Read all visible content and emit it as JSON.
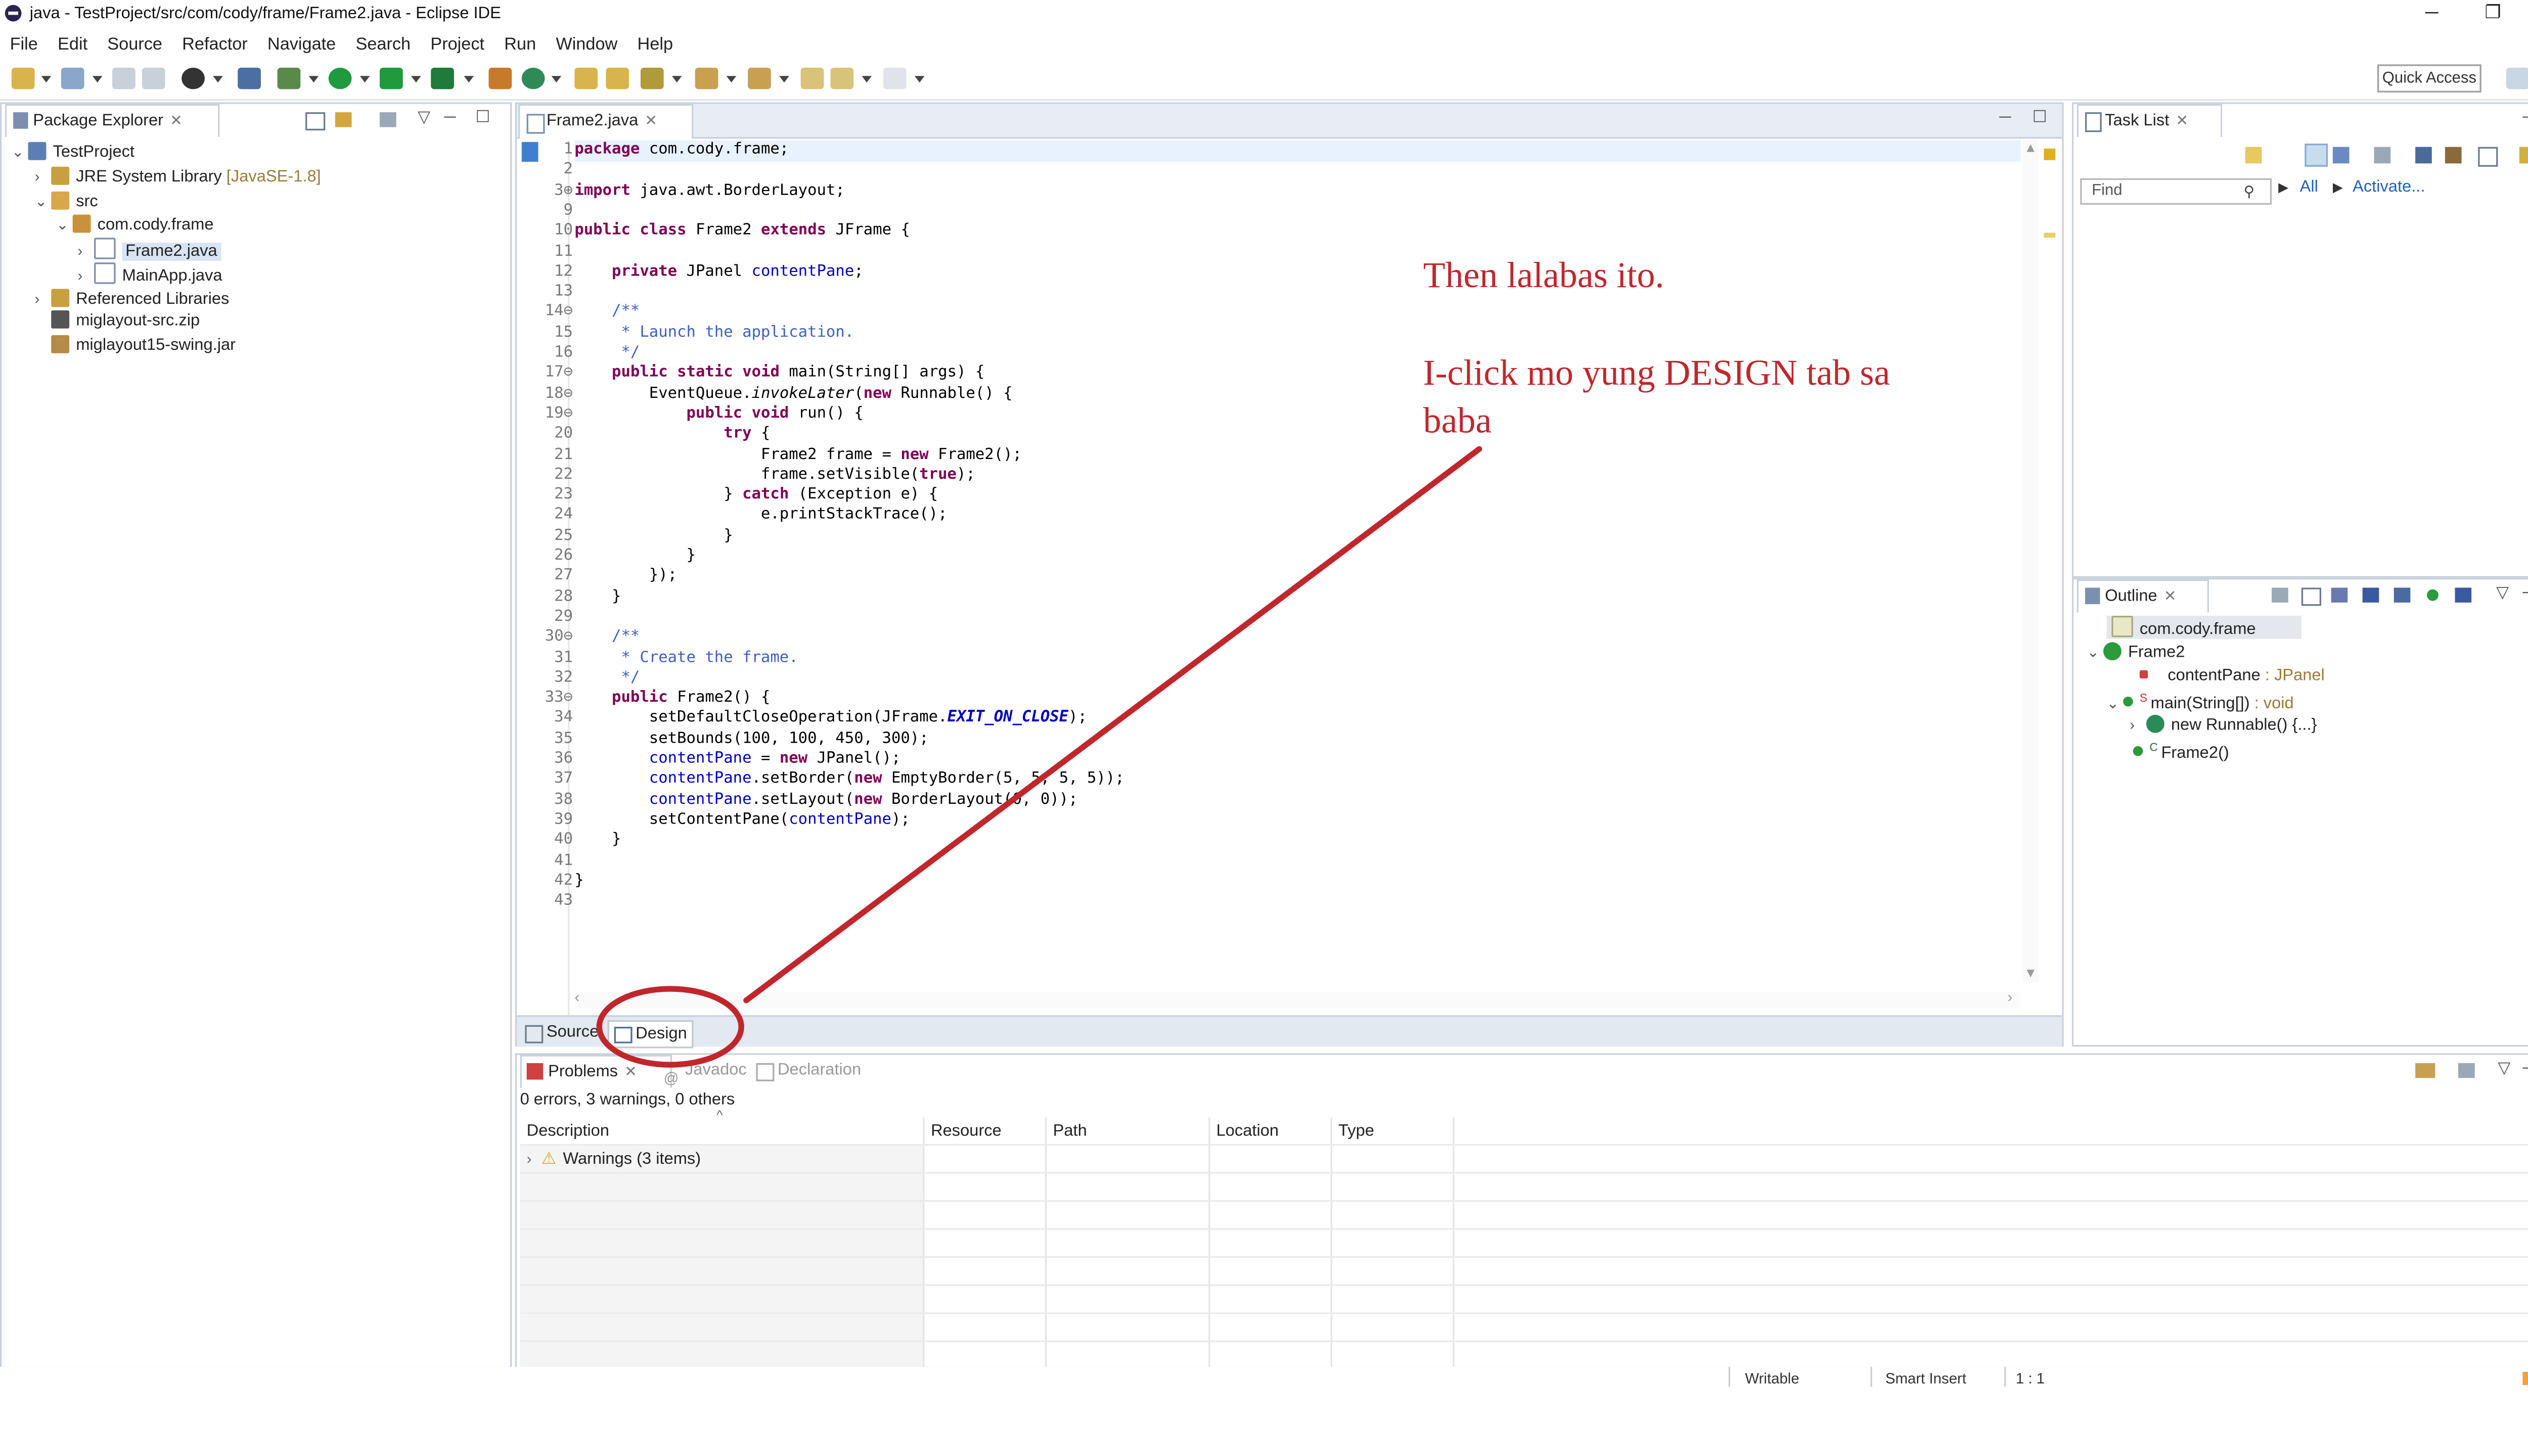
{
  "window": {
    "title": "java - TestProject/src/com/cody/frame/Frame2.java - Eclipse IDE",
    "controls": [
      "─",
      "❐",
      "✕"
    ]
  },
  "menu": [
    "File",
    "Edit",
    "Source",
    "Refactor",
    "Navigate",
    "Search",
    "Project",
    "Run",
    "Window",
    "Help"
  ],
  "toolbar": {
    "quick_access": "Quick Access"
  },
  "package_explorer": {
    "title": "Package Explorer",
    "tree": [
      {
        "label": "TestProject",
        "suffix": ""
      },
      {
        "label": "JRE System Library",
        "suffix": "[JavaSE-1.8]"
      },
      {
        "label": "src",
        "suffix": ""
      },
      {
        "label": "com.cody.frame",
        "suffix": ""
      },
      {
        "label": "Frame2.java",
        "suffix": ""
      },
      {
        "label": "MainApp.java",
        "suffix": ""
      },
      {
        "label": "Referenced Libraries",
        "suffix": ""
      },
      {
        "label": "miglayout-src.zip",
        "suffix": ""
      },
      {
        "label": "miglayout15-swing.jar",
        "suffix": ""
      }
    ]
  },
  "editor": {
    "tab": "Frame2.java",
    "lines": [
      {
        "n": "1",
        "t": "package com.cody.frame;"
      },
      {
        "n": "2",
        "t": ""
      },
      {
        "n": "3⊕",
        "t": "import java.awt.BorderLayout;"
      },
      {
        "n": "9",
        "t": ""
      },
      {
        "n": "10",
        "t": "public class Frame2 extends JFrame {"
      },
      {
        "n": "11",
        "t": ""
      },
      {
        "n": "12",
        "t": "    private JPanel contentPane;"
      },
      {
        "n": "13",
        "t": ""
      },
      {
        "n": "14⊖",
        "t": "    /**"
      },
      {
        "n": "15",
        "t": "     * Launch the application."
      },
      {
        "n": "16",
        "t": "     */"
      },
      {
        "n": "17⊖",
        "t": "    public static void main(String[] args) {"
      },
      {
        "n": "18⊖",
        "t": "        EventQueue.invokeLater(new Runnable() {"
      },
      {
        "n": "19⊖",
        "t": "            public void run() {"
      },
      {
        "n": "20",
        "t": "                try {"
      },
      {
        "n": "21",
        "t": "                    Frame2 frame = new Frame2();"
      },
      {
        "n": "22",
        "t": "                    frame.setVisible(true);"
      },
      {
        "n": "23",
        "t": "                } catch (Exception e) {"
      },
      {
        "n": "24",
        "t": "                    e.printStackTrace();"
      },
      {
        "n": "25",
        "t": "                }"
      },
      {
        "n": "26",
        "t": "            }"
      },
      {
        "n": "27",
        "t": "        });"
      },
      {
        "n": "28",
        "t": "    }"
      },
      {
        "n": "29",
        "t": ""
      },
      {
        "n": "30⊖",
        "t": "    /**"
      },
      {
        "n": "31",
        "t": "     * Create the frame."
      },
      {
        "n": "32",
        "t": "     */"
      },
      {
        "n": "33⊖",
        "t": "    public Frame2() {"
      },
      {
        "n": "34",
        "t": "        setDefaultCloseOperation(JFrame.EXIT_ON_CLOSE);"
      },
      {
        "n": "35",
        "t": "        setBounds(100, 100, 450, 300);"
      },
      {
        "n": "36",
        "t": "        contentPane = new JPanel();"
      },
      {
        "n": "37",
        "t": "        contentPane.setBorder(new EmptyBorder(5, 5, 5, 5));"
      },
      {
        "n": "38",
        "t": "        contentPane.setLayout(new BorderLayout(0, 0));"
      },
      {
        "n": "39",
        "t": "        setContentPane(contentPane);"
      },
      {
        "n": "40",
        "t": "    }"
      },
      {
        "n": "41",
        "t": ""
      },
      {
        "n": "42",
        "t": "}"
      },
      {
        "n": "43",
        "t": ""
      }
    ],
    "bottom_tabs": {
      "source": "Source",
      "design": "Design"
    }
  },
  "task_list": {
    "title": "Task List",
    "find_placeholder": "Find",
    "all": "All",
    "activate": "Activate..."
  },
  "outline": {
    "title": "Outline",
    "items": [
      {
        "label": "com.cody.frame",
        "type": ""
      },
      {
        "label": "Frame2",
        "type": ""
      },
      {
        "label": "contentPane",
        "type": " : JPanel"
      },
      {
        "label": "main(String[])",
        "type": " : void"
      },
      {
        "label": "new Runnable() {...}",
        "type": ""
      },
      {
        "label": "Frame2()",
        "type": ""
      }
    ]
  },
  "problems": {
    "tabs": [
      "Problems",
      "Javadoc",
      "Declaration"
    ],
    "summary": "0 errors, 3 warnings, 0 others",
    "columns": [
      "Description",
      "Resource",
      "Path",
      "Location",
      "Type"
    ],
    "rows": [
      {
        "description": "Warnings (3 items)"
      }
    ]
  },
  "status": {
    "writable": "Writable",
    "insert": "Smart Insert",
    "position": "1 : 1"
  },
  "annotation": {
    "line1": "Then lalabas ito.",
    "line2": "I-click mo yung DESIGN tab sa baba"
  },
  "colors": {
    "annotation": "#c0272d",
    "keyword": "#7f0055",
    "comment": "#3f5fbf",
    "field": "#0000c0"
  }
}
